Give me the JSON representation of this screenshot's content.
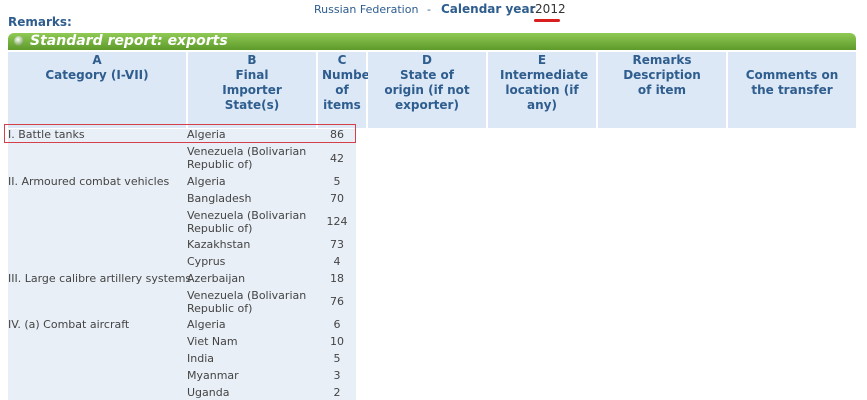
{
  "header": {
    "country": "Russian Federation",
    "separator": "-",
    "calendar_label": "Calendar year",
    "colon": ":",
    "year": "2012"
  },
  "remarks_label": "Remarks:",
  "report_title": "Standard report: exports",
  "columns": [
    {
      "letter": "A",
      "label": "Category (I-VII)"
    },
    {
      "letter": "B",
      "label": "Final Importer State(s)"
    },
    {
      "letter": "C",
      "label": "Number of items"
    },
    {
      "letter": "D",
      "label": "State of origin (if not exporter)"
    },
    {
      "letter": "E",
      "label": "Intermediate location (if any)"
    },
    {
      "letter": "Remarks",
      "label": "Description of item"
    },
    {
      "letter": "",
      "label": "Comments on the transfer"
    }
  ],
  "rows": [
    {
      "category": "I. Battle tanks",
      "importer": "Algeria",
      "number": "86"
    },
    {
      "category": "",
      "importer": "Venezuela (Bolivarian Republic of)",
      "number": "42"
    },
    {
      "category": "II. Armoured combat vehicles",
      "importer": "Algeria",
      "number": "5"
    },
    {
      "category": "",
      "importer": "Bangladesh",
      "number": "70"
    },
    {
      "category": "",
      "importer": "Venezuela (Bolivarian Republic of)",
      "number": "124"
    },
    {
      "category": "",
      "importer": "Kazakhstan",
      "number": "73"
    },
    {
      "category": "",
      "importer": "Cyprus",
      "number": "4"
    },
    {
      "category": "III. Large calibre artillery systems",
      "importer": "Azerbaijan",
      "number": "18"
    },
    {
      "category": "",
      "importer": "Venezuela (Bolivarian Republic of)",
      "number": "76"
    },
    {
      "category": "IV. (a) Combat aircraft",
      "importer": "Algeria",
      "number": "6"
    },
    {
      "category": "",
      "importer": "Viet Nam",
      "number": "10"
    },
    {
      "category": "",
      "importer": "India",
      "number": "5"
    },
    {
      "category": "",
      "importer": "Myanmar",
      "number": "3"
    },
    {
      "category": "",
      "importer": "Uganda",
      "number": "2"
    }
  ]
}
